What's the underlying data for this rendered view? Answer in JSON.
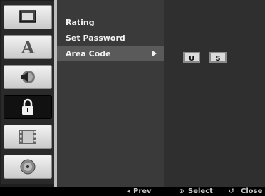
{
  "icon_tabs": [
    {
      "icon": "display-icon"
    },
    {
      "icon": "language-icon"
    },
    {
      "icon": "audio-icon"
    },
    {
      "icon": "lock-icon",
      "active": true
    },
    {
      "icon": "film-icon"
    },
    {
      "icon": "disc-icon"
    }
  ],
  "menu": {
    "items": [
      {
        "label": "Rating"
      },
      {
        "label": "Set Password"
      },
      {
        "label": "Area Code",
        "selected": true
      }
    ]
  },
  "area_code": {
    "chars": [
      "U",
      "S"
    ]
  },
  "footer": {
    "prev_icon": "◂",
    "prev_label": "Prev",
    "select_icon": "⊙",
    "select_label": "Select",
    "close_icon": "↺",
    "close_label": "Close"
  },
  "colors": {
    "background": "#1f1f1f",
    "menu_bg": "#3a3a3a",
    "selected_bg": "#5a5a5a",
    "active_tab": "#111111",
    "text": "#f2f2f2"
  }
}
